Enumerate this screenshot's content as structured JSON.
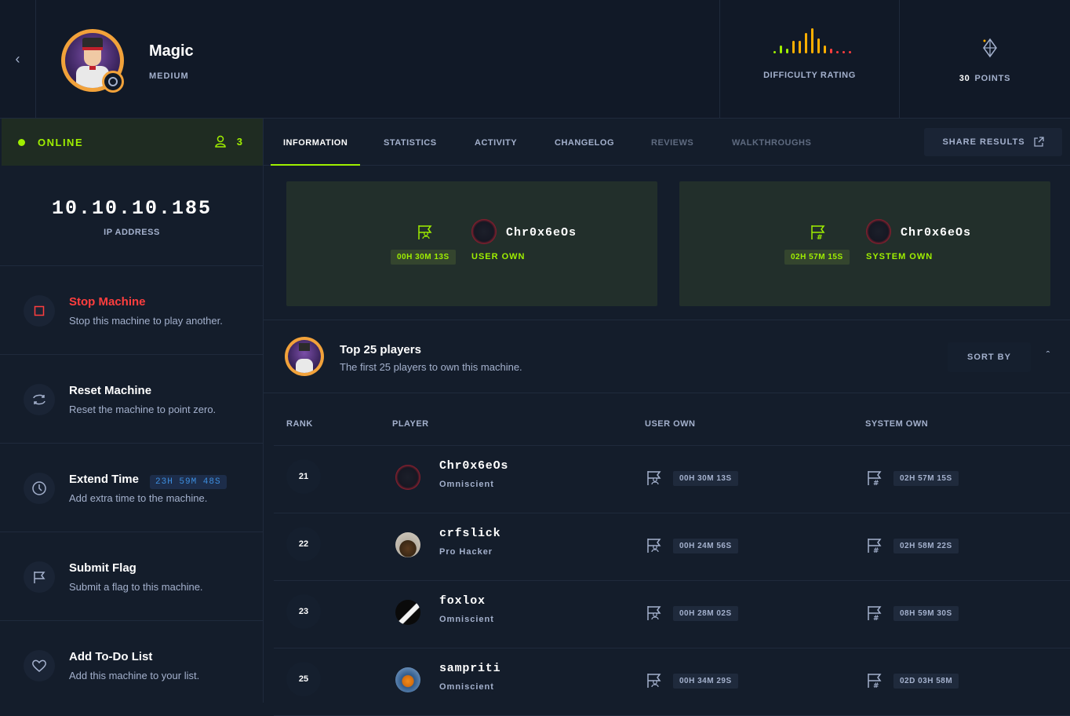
{
  "machine": {
    "name": "Magic",
    "difficulty": "MEDIUM",
    "difficulty_label": "DIFFICULTY RATING",
    "difficulty_bars": [
      1,
      3,
      2,
      5,
      5,
      8,
      10,
      6,
      3,
      2,
      1,
      1,
      1
    ],
    "points_value": "30",
    "points_label": "POINTS"
  },
  "status": {
    "online_label": "ONLINE",
    "players_count": "3",
    "ip": "10.10.10.185",
    "ip_label": "IP ADDRESS"
  },
  "actions": [
    {
      "title": "Stop Machine",
      "desc": "Stop this machine to play another."
    },
    {
      "title": "Reset Machine",
      "desc": "Reset the machine to point zero."
    },
    {
      "title": "Extend Time",
      "desc": "Add extra time to the machine.",
      "badge": "23H 59M 48S"
    },
    {
      "title": "Submit Flag",
      "desc": "Submit a flag to this machine."
    },
    {
      "title": "Add To-Do List",
      "desc": "Add this machine to your list."
    }
  ],
  "tabs": [
    "INFORMATION",
    "STATISTICS",
    "ACTIVITY",
    "CHANGELOG",
    "REVIEWS",
    "WALKTHROUGHS"
  ],
  "share_label": "SHARE RESULTS",
  "first_bloods": [
    {
      "player": "Chr0x6eOs",
      "time": "00H 30M 13S",
      "type": "USER OWN"
    },
    {
      "player": "Chr0x6eOs",
      "time": "02H 57M 15S",
      "type": "SYSTEM OWN"
    }
  ],
  "top_players": {
    "title": "Top 25 players",
    "subtitle": "The first 25 players to own this machine.",
    "sort_label": "SORT BY",
    "columns": [
      "RANK",
      "PLAYER",
      "USER OWN",
      "SYSTEM OWN"
    ],
    "rows": [
      {
        "rank": "21",
        "name": "Chr0x6eOs",
        "title": "Omniscient",
        "user": "00H 30M 13S",
        "system": "02H 57M 15S"
      },
      {
        "rank": "22",
        "name": "crfslick",
        "title": "Pro Hacker",
        "user": "00H 24M 56S",
        "system": "02H 58M 22S"
      },
      {
        "rank": "23",
        "name": "foxlox",
        "title": "Omniscient",
        "user": "00H 28M 02S",
        "system": "08H 59M 30S"
      },
      {
        "rank": "25",
        "name": "sampriti",
        "title": "Omniscient",
        "user": "00H 34M 29S",
        "system": "02D 03H 58M"
      }
    ]
  },
  "colors": {
    "accent": "#9fef00",
    "danger": "#ff3e3e",
    "difficulty_green": "#9fef00",
    "difficulty_orange": "#ffaf00",
    "difficulty_red": "#ff3e3e"
  }
}
